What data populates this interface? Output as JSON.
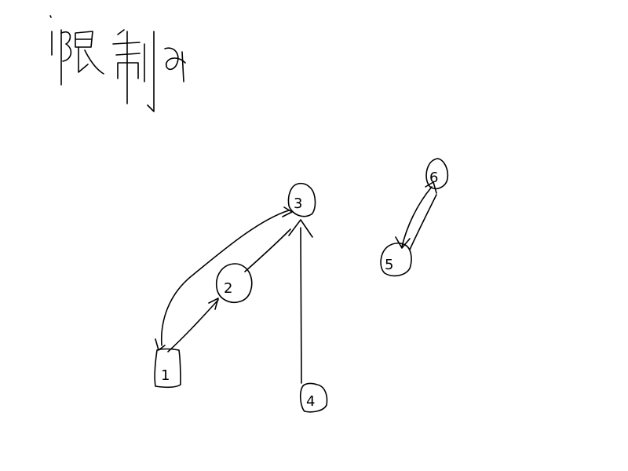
{
  "title": "限制的",
  "nodes": [
    {
      "id": "node-1",
      "label": "1"
    },
    {
      "id": "node-2",
      "label": "2"
    },
    {
      "id": "node-3",
      "label": "3"
    },
    {
      "id": "node-4",
      "label": "4"
    },
    {
      "id": "node-5",
      "label": "5"
    },
    {
      "id": "node-6",
      "label": "6"
    }
  ],
  "edges": [
    {
      "from": "1",
      "to": "3",
      "directed": true
    },
    {
      "from": "1",
      "to": "2",
      "directed": true
    },
    {
      "from": "2",
      "to": "3",
      "directed": true
    },
    {
      "from": "4",
      "to": "3",
      "directed": true
    },
    {
      "from": "5",
      "to": "6",
      "directed": true
    },
    {
      "from": "6",
      "to": "5",
      "directed": true
    }
  ]
}
